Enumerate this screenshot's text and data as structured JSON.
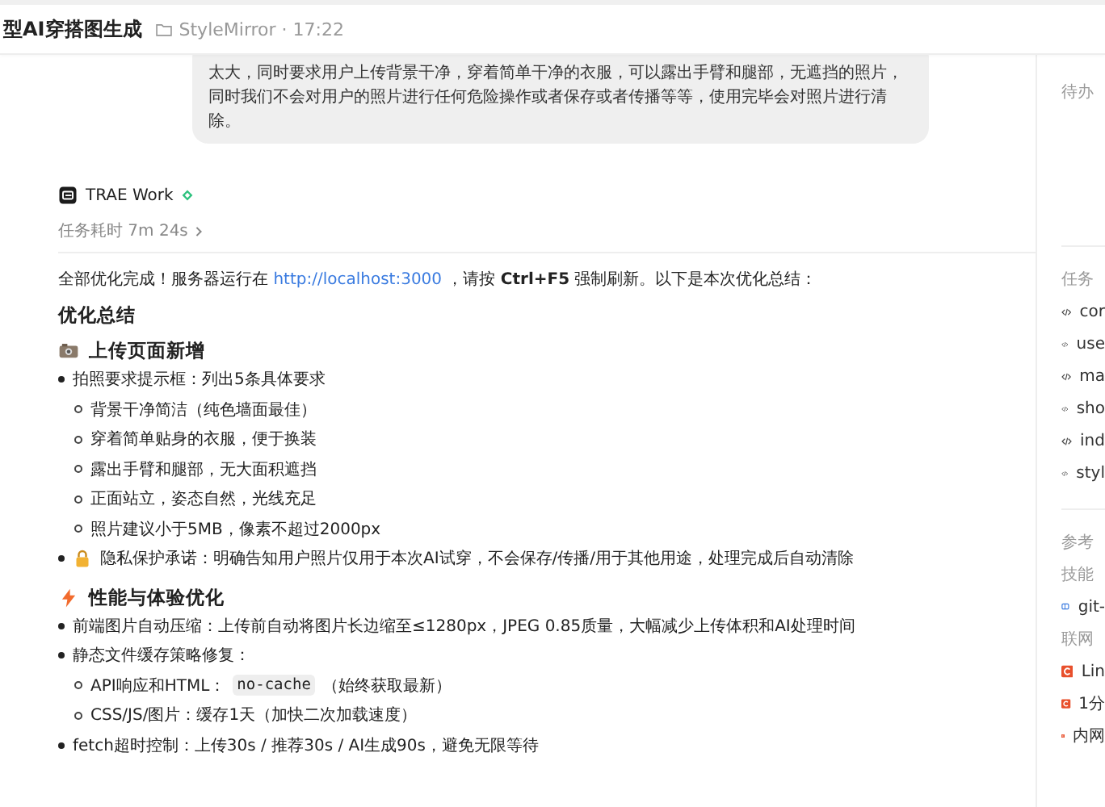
{
  "header": {
    "title": "型AI穿搭图生成",
    "project": "StyleMirror · 17:22"
  },
  "user_message": "太大，同时要求用户上传背景干净，穿着简单干净的衣服，可以露出手臂和腿部，无遮挡的照片，同时我们不会对用户的照片进行任何危险操作或者保存或者传播等等，使用完毕会对照片进行清除。",
  "reply": {
    "agent": "TRAE Work",
    "duration": "任务耗时 7m 24s",
    "intro": {
      "before": "全部优化完成！服务器运行在 ",
      "link": "http://localhost:3000",
      "after": " ，请按 **Ctrl+F5** 强制刷新。以下是本次优化总结："
    },
    "summary_title": "优化总结",
    "sections": [
      {
        "kind": "camera",
        "title": "上传页面新增",
        "items": [
          {
            "text": "拍照要求提示框：列出5条具体要求",
            "children": [
              {
                "text": "背景干净简洁（纯色墙面最佳）"
              },
              {
                "text": "穿着简单贴身的衣服，便于换装"
              },
              {
                "text": "露出手臂和腿部，无大面积遮挡"
              },
              {
                "text": "正面站立，姿态自然，光线充足"
              },
              {
                "text": "照片建议小于5MB，像素不超过2000px"
              }
            ]
          },
          {
            "kind": "lock",
            "text": "隐私保护承诺：明确告知用户照片仅用于本次AI试穿，不会保存/传播/用于其他用途，处理完成后自动清除"
          }
        ]
      },
      {
        "kind": "bolt",
        "title": "性能与体验优化",
        "items": [
          {
            "text": "前端图片自动压缩：上传前自动将图片长边缩至≤1280px，JPEG 0.85质量，大幅减少上传体积和AI处理时间"
          },
          {
            "text": "静态文件缓存策略修复：",
            "children": [
              {
                "text": "API响应和HTML：",
                "code": "no-cache",
                "after": "（始终获取最新）"
              },
              {
                "text": "CSS/JS/图片：缓存1天（加快二次加载速度）"
              }
            ]
          },
          {
            "text": "fetch超时控制：上传30s / 推荐30s / AI生成90s，避免无限等待"
          }
        ]
      }
    ]
  },
  "side": {
    "todo_title": "待办",
    "outputs_title": "任务",
    "outputs": [
      "cor",
      "use",
      "ma",
      "sho",
      "ind",
      "styl"
    ],
    "refs_title": "参考",
    "skills_title": "技能",
    "skills": [
      "git-"
    ],
    "web_title": "联网",
    "web": [
      "Lin",
      "1分",
      "内网"
    ]
  }
}
